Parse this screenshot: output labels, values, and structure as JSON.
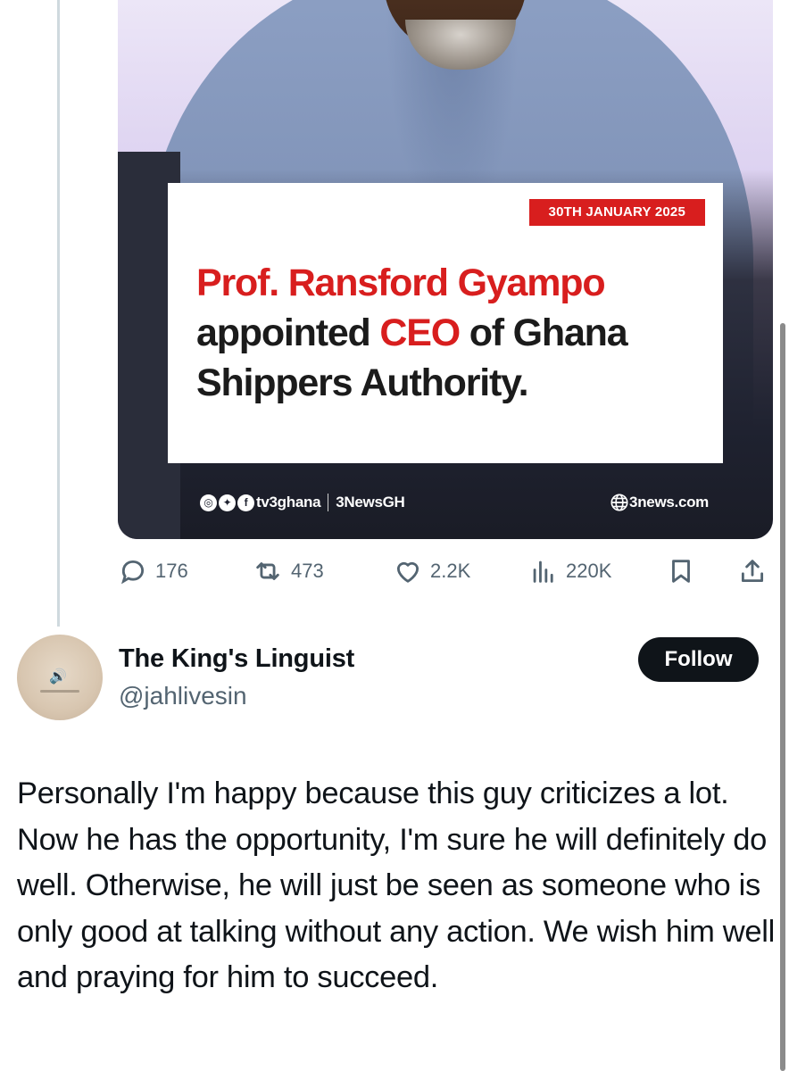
{
  "media": {
    "date_badge": "30TH JANUARY 2025",
    "headline": {
      "line1": "Prof. Ransford Gyampo",
      "line2_pre": "appointed ",
      "line2_red": "CEO",
      "line2_post": " of Ghana",
      "line3": "Shippers Authority."
    },
    "social_handle": "tv3ghana",
    "social_handle2": "3NewsGH",
    "website": "3news.com",
    "colors": {
      "brand_red": "#d81e1e"
    }
  },
  "actions": {
    "replies": "176",
    "reposts": "473",
    "likes": "2.2K",
    "views": "220K"
  },
  "reply": {
    "display_name": "The King's Linguist",
    "handle": "@jahlivesin",
    "follow_label": "Follow",
    "text": "Personally I'm happy because this guy criticizes a lot. Now he has the opportunity, I'm sure he will definitely do well. Otherwise, he will just be seen as someone who is only good at talking without any action. We wish him well and praying for him to succeed."
  },
  "icons": {
    "reply": "reply-icon",
    "repost": "repost-icon",
    "like": "like-icon",
    "views": "views-icon",
    "bookmark": "bookmark-icon",
    "share": "share-icon"
  }
}
